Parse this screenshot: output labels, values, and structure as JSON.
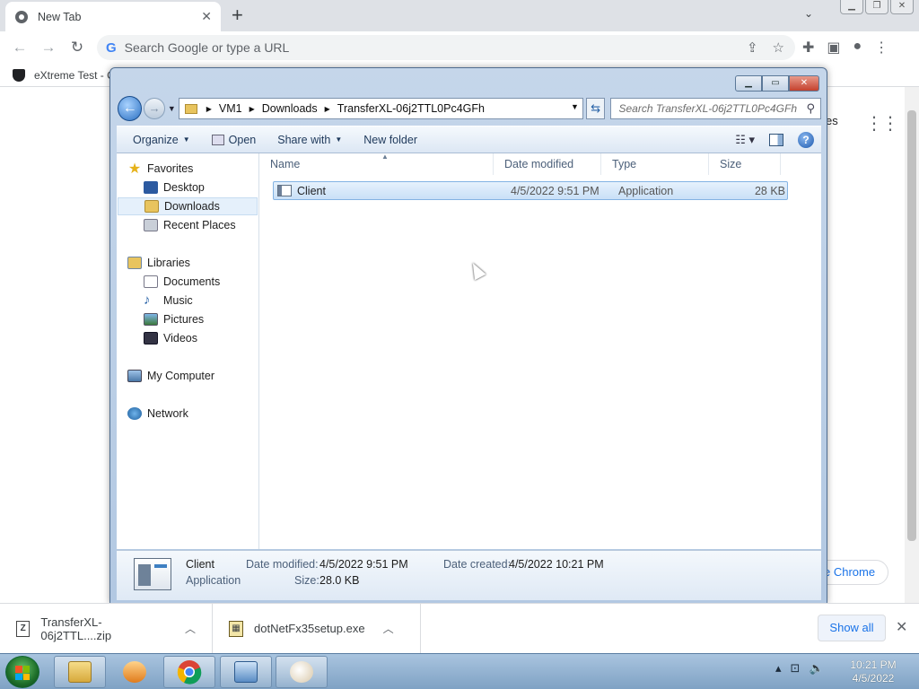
{
  "chrome": {
    "tab_title": "New Tab",
    "tab_close": "✕",
    "new_tab": "+",
    "tab_search": "⌄",
    "omnibox_placeholder": "Search Google or type a URL",
    "bookmark": "eXtreme Test - C"
  },
  "ntp": {
    "peek_images": "es",
    "peek_chrome": "e Chrome"
  },
  "explorer": {
    "path": [
      "VM1",
      "Downloads",
      "TransferXL-06j2TTL0Pc4GFh"
    ],
    "search_placeholder": "Search TransferXL-06j2TTL0Pc4GFh",
    "commands": {
      "organize": "Organize",
      "open": "Open",
      "share_with": "Share with",
      "new_folder": "New folder"
    },
    "nav": {
      "favorites": "Favorites",
      "desktop": "Desktop",
      "downloads": "Downloads",
      "recent_places": "Recent Places",
      "libraries": "Libraries",
      "documents": "Documents",
      "music": "Music",
      "pictures": "Pictures",
      "videos": "Videos",
      "my_computer": "My Computer",
      "network": "Network"
    },
    "columns": {
      "name": "Name",
      "date_modified": "Date modified",
      "type": "Type",
      "size": "Size"
    },
    "files": [
      {
        "name": "Client",
        "date_modified": "4/5/2022 9:51 PM",
        "type": "Application",
        "size": "28 KB"
      }
    ],
    "details": {
      "name": "Client",
      "type": "Application",
      "date_modified_label": "Date modified:",
      "date_modified": "4/5/2022 9:51 PM",
      "size_label": "Size:",
      "size": "28.0 KB",
      "date_created_label": "Date created:",
      "date_created": "4/5/2022 10:21 PM"
    }
  },
  "downloads": {
    "items": [
      {
        "name": "TransferXL-06j2TTL....zip"
      },
      {
        "name": "dotNetFx35setup.exe"
      }
    ],
    "show_all": "Show all"
  },
  "taskbar": {
    "time": "10:21 PM",
    "date": "4/5/2022"
  },
  "colors": {
    "chrome_accent": "#1a73e8",
    "explorer_frame": "#b2c8e2",
    "taskbar": "#8fb0d0"
  }
}
